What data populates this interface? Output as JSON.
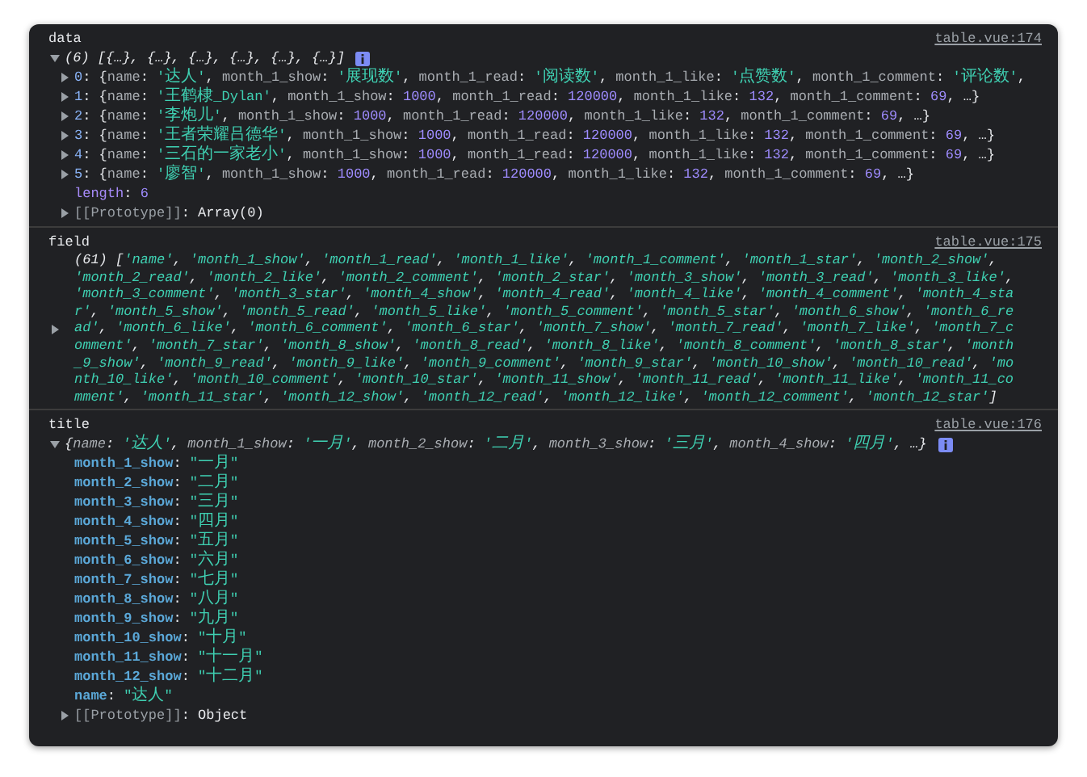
{
  "entries": [
    {
      "label": "data",
      "source": "table.vue:174",
      "expanded": true,
      "info": true,
      "summary": [
        {
          "kind": "p",
          "text": "(6) [{…}, {…}, {…}, {…}, {…}, {…}]"
        }
      ],
      "lines": [
        {
          "kind": "child",
          "expanded": false,
          "tokens": [
            {
              "kind": "x",
              "text": "0"
            },
            {
              "kind": "p",
              "text": ": {"
            },
            {
              "kind": "k",
              "text": "name"
            },
            {
              "kind": "p",
              "text": ": "
            },
            {
              "kind": "s",
              "text": "'达人'"
            },
            {
              "kind": "p",
              "text": ", "
            },
            {
              "kind": "k",
              "text": "month_1_show"
            },
            {
              "kind": "p",
              "text": ": "
            },
            {
              "kind": "s",
              "text": "'展现数'"
            },
            {
              "kind": "p",
              "text": ", "
            },
            {
              "kind": "k",
              "text": "month_1_read"
            },
            {
              "kind": "p",
              "text": ": "
            },
            {
              "kind": "s",
              "text": "'阅读数'"
            },
            {
              "kind": "p",
              "text": ", "
            },
            {
              "kind": "k",
              "text": "month_1_like"
            },
            {
              "kind": "p",
              "text": ": "
            },
            {
              "kind": "s",
              "text": "'点赞数'"
            },
            {
              "kind": "p",
              "text": ", "
            },
            {
              "kind": "k",
              "text": "month_1_comment"
            },
            {
              "kind": "p",
              "text": ": "
            },
            {
              "kind": "s",
              "text": "'评论数'"
            },
            {
              "kind": "p",
              "text": ","
            }
          ]
        },
        {
          "kind": "child",
          "expanded": false,
          "tokens": [
            {
              "kind": "x",
              "text": "1"
            },
            {
              "kind": "p",
              "text": ": {"
            },
            {
              "kind": "k",
              "text": "name"
            },
            {
              "kind": "p",
              "text": ": "
            },
            {
              "kind": "s",
              "text": "'王鹤棣_Dylan'"
            },
            {
              "kind": "p",
              "text": ", "
            },
            {
              "kind": "k",
              "text": "month_1_show"
            },
            {
              "kind": "p",
              "text": ": "
            },
            {
              "kind": "n",
              "text": "1000"
            },
            {
              "kind": "p",
              "text": ", "
            },
            {
              "kind": "k",
              "text": "month_1_read"
            },
            {
              "kind": "p",
              "text": ": "
            },
            {
              "kind": "n",
              "text": "120000"
            },
            {
              "kind": "p",
              "text": ", "
            },
            {
              "kind": "k",
              "text": "month_1_like"
            },
            {
              "kind": "p",
              "text": ": "
            },
            {
              "kind": "n",
              "text": "132"
            },
            {
              "kind": "p",
              "text": ", "
            },
            {
              "kind": "k",
              "text": "month_1_comment"
            },
            {
              "kind": "p",
              "text": ": "
            },
            {
              "kind": "n",
              "text": "69"
            },
            {
              "kind": "p",
              "text": ", …}"
            }
          ]
        },
        {
          "kind": "child",
          "expanded": false,
          "tokens": [
            {
              "kind": "x",
              "text": "2"
            },
            {
              "kind": "p",
              "text": ": {"
            },
            {
              "kind": "k",
              "text": "name"
            },
            {
              "kind": "p",
              "text": ": "
            },
            {
              "kind": "s",
              "text": "'李炮儿'"
            },
            {
              "kind": "p",
              "text": ", "
            },
            {
              "kind": "k",
              "text": "month_1_show"
            },
            {
              "kind": "p",
              "text": ": "
            },
            {
              "kind": "n",
              "text": "1000"
            },
            {
              "kind": "p",
              "text": ", "
            },
            {
              "kind": "k",
              "text": "month_1_read"
            },
            {
              "kind": "p",
              "text": ": "
            },
            {
              "kind": "n",
              "text": "120000"
            },
            {
              "kind": "p",
              "text": ", "
            },
            {
              "kind": "k",
              "text": "month_1_like"
            },
            {
              "kind": "p",
              "text": ": "
            },
            {
              "kind": "n",
              "text": "132"
            },
            {
              "kind": "p",
              "text": ", "
            },
            {
              "kind": "k",
              "text": "month_1_comment"
            },
            {
              "kind": "p",
              "text": ": "
            },
            {
              "kind": "n",
              "text": "69"
            },
            {
              "kind": "p",
              "text": ", …}"
            }
          ]
        },
        {
          "kind": "child",
          "expanded": false,
          "tokens": [
            {
              "kind": "x",
              "text": "3"
            },
            {
              "kind": "p",
              "text": ": {"
            },
            {
              "kind": "k",
              "text": "name"
            },
            {
              "kind": "p",
              "text": ": "
            },
            {
              "kind": "s",
              "text": "'王者荣耀吕德华'"
            },
            {
              "kind": "p",
              "text": ", "
            },
            {
              "kind": "k",
              "text": "month_1_show"
            },
            {
              "kind": "p",
              "text": ": "
            },
            {
              "kind": "n",
              "text": "1000"
            },
            {
              "kind": "p",
              "text": ", "
            },
            {
              "kind": "k",
              "text": "month_1_read"
            },
            {
              "kind": "p",
              "text": ": "
            },
            {
              "kind": "n",
              "text": "120000"
            },
            {
              "kind": "p",
              "text": ", "
            },
            {
              "kind": "k",
              "text": "month_1_like"
            },
            {
              "kind": "p",
              "text": ": "
            },
            {
              "kind": "n",
              "text": "132"
            },
            {
              "kind": "p",
              "text": ", "
            },
            {
              "kind": "k",
              "text": "month_1_comment"
            },
            {
              "kind": "p",
              "text": ": "
            },
            {
              "kind": "n",
              "text": "69"
            },
            {
              "kind": "p",
              "text": ", …}"
            }
          ]
        },
        {
          "kind": "child",
          "expanded": false,
          "tokens": [
            {
              "kind": "x",
              "text": "4"
            },
            {
              "kind": "p",
              "text": ": {"
            },
            {
              "kind": "k",
              "text": "name"
            },
            {
              "kind": "p",
              "text": ": "
            },
            {
              "kind": "s",
              "text": "'三石的一家老小'"
            },
            {
              "kind": "p",
              "text": ", "
            },
            {
              "kind": "k",
              "text": "month_1_show"
            },
            {
              "kind": "p",
              "text": ": "
            },
            {
              "kind": "n",
              "text": "1000"
            },
            {
              "kind": "p",
              "text": ", "
            },
            {
              "kind": "k",
              "text": "month_1_read"
            },
            {
              "kind": "p",
              "text": ": "
            },
            {
              "kind": "n",
              "text": "120000"
            },
            {
              "kind": "p",
              "text": ", "
            },
            {
              "kind": "k",
              "text": "month_1_like"
            },
            {
              "kind": "p",
              "text": ": "
            },
            {
              "kind": "n",
              "text": "132"
            },
            {
              "kind": "p",
              "text": ", "
            },
            {
              "kind": "k",
              "text": "month_1_comment"
            },
            {
              "kind": "p",
              "text": ": "
            },
            {
              "kind": "n",
              "text": "69"
            },
            {
              "kind": "p",
              "text": ", …}"
            }
          ]
        },
        {
          "kind": "child",
          "expanded": false,
          "tokens": [
            {
              "kind": "x",
              "text": "5"
            },
            {
              "kind": "p",
              "text": ": {"
            },
            {
              "kind": "k",
              "text": "name"
            },
            {
              "kind": "p",
              "text": ": "
            },
            {
              "kind": "s",
              "text": "'廖智'"
            },
            {
              "kind": "p",
              "text": ", "
            },
            {
              "kind": "k",
              "text": "month_1_show"
            },
            {
              "kind": "p",
              "text": ": "
            },
            {
              "kind": "n",
              "text": "1000"
            },
            {
              "kind": "p",
              "text": ", "
            },
            {
              "kind": "k",
              "text": "month_1_read"
            },
            {
              "kind": "p",
              "text": ": "
            },
            {
              "kind": "n",
              "text": "120000"
            },
            {
              "kind": "p",
              "text": ", "
            },
            {
              "kind": "k",
              "text": "month_1_like"
            },
            {
              "kind": "p",
              "text": ": "
            },
            {
              "kind": "n",
              "text": "132"
            },
            {
              "kind": "p",
              "text": ", "
            },
            {
              "kind": "k",
              "text": "month_1_comment"
            },
            {
              "kind": "p",
              "text": ": "
            },
            {
              "kind": "n",
              "text": "69"
            },
            {
              "kind": "p",
              "text": ", …}"
            }
          ]
        },
        {
          "kind": "prop",
          "tokens": [
            {
              "kind": "m",
              "text": "length"
            },
            {
              "kind": "p",
              "text": ": "
            },
            {
              "kind": "n",
              "text": "6"
            }
          ]
        },
        {
          "kind": "child",
          "expanded": false,
          "tokens": [
            {
              "kind": "g",
              "text": "[[Prototype]]"
            },
            {
              "kind": "p",
              "text": ": "
            },
            {
              "kind": "p",
              "text": "Array(0)"
            }
          ]
        }
      ]
    },
    {
      "label": "field",
      "source": "table.vue:175",
      "expanded": false,
      "info": false,
      "summary": [
        {
          "kind": "p",
          "text": "(61) ["
        },
        {
          "kind": "s",
          "text": "'name'"
        },
        {
          "kind": "p",
          "text": ", "
        },
        {
          "kind": "s",
          "text": "'month_1_show'"
        },
        {
          "kind": "p",
          "text": ", "
        },
        {
          "kind": "s",
          "text": "'month_1_read'"
        },
        {
          "kind": "p",
          "text": ", "
        },
        {
          "kind": "s",
          "text": "'month_1_like'"
        },
        {
          "kind": "p",
          "text": ", "
        },
        {
          "kind": "s",
          "text": "'month_1_comment'"
        },
        {
          "kind": "p",
          "text": ", "
        },
        {
          "kind": "s",
          "text": "'month_1_star'"
        },
        {
          "kind": "p",
          "text": ", "
        },
        {
          "kind": "s",
          "text": "'month_2_show'"
        },
        {
          "kind": "p",
          "text": ", "
        },
        {
          "kind": "s",
          "text": "'month_2_read'"
        },
        {
          "kind": "p",
          "text": ", "
        },
        {
          "kind": "s",
          "text": "'month_2_like'"
        },
        {
          "kind": "p",
          "text": ", "
        },
        {
          "kind": "s",
          "text": "'month_2_comment'"
        },
        {
          "kind": "p",
          "text": ", "
        },
        {
          "kind": "s",
          "text": "'month_2_star'"
        },
        {
          "kind": "p",
          "text": ", "
        },
        {
          "kind": "s",
          "text": "'month_3_show'"
        },
        {
          "kind": "p",
          "text": ", "
        },
        {
          "kind": "s",
          "text": "'month_3_read'"
        },
        {
          "kind": "p",
          "text": ", "
        },
        {
          "kind": "s",
          "text": "'month_3_like'"
        },
        {
          "kind": "p",
          "text": ", "
        },
        {
          "kind": "s",
          "text": "'month_3_comment'"
        },
        {
          "kind": "p",
          "text": ", "
        },
        {
          "kind": "s",
          "text": "'month_3_star'"
        },
        {
          "kind": "p",
          "text": ", "
        },
        {
          "kind": "s",
          "text": "'month_4_show'"
        },
        {
          "kind": "p",
          "text": ", "
        },
        {
          "kind": "s",
          "text": "'month_4_read'"
        },
        {
          "kind": "p",
          "text": ", "
        },
        {
          "kind": "s",
          "text": "'month_4_like'"
        },
        {
          "kind": "p",
          "text": ", "
        },
        {
          "kind": "s",
          "text": "'month_4_comment'"
        },
        {
          "kind": "p",
          "text": ", "
        },
        {
          "kind": "s",
          "text": "'month_4_star'"
        },
        {
          "kind": "p",
          "text": ", "
        },
        {
          "kind": "s",
          "text": "'month_5_show'"
        },
        {
          "kind": "p",
          "text": ", "
        },
        {
          "kind": "s",
          "text": "'month_5_read'"
        },
        {
          "kind": "p",
          "text": ", "
        },
        {
          "kind": "s",
          "text": "'month_5_like'"
        },
        {
          "kind": "p",
          "text": ", "
        },
        {
          "kind": "s",
          "text": "'month_5_comment'"
        },
        {
          "kind": "p",
          "text": ", "
        },
        {
          "kind": "s",
          "text": "'month_5_star'"
        },
        {
          "kind": "p",
          "text": ", "
        },
        {
          "kind": "s",
          "text": "'month_6_show'"
        },
        {
          "kind": "p",
          "text": ", "
        },
        {
          "kind": "s",
          "text": "'month_6_read'"
        },
        {
          "kind": "p",
          "text": ", "
        },
        {
          "kind": "s",
          "text": "'month_6_like'"
        },
        {
          "kind": "p",
          "text": ", "
        },
        {
          "kind": "s",
          "text": "'month_6_comment'"
        },
        {
          "kind": "p",
          "text": ", "
        },
        {
          "kind": "s",
          "text": "'month_6_star'"
        },
        {
          "kind": "p",
          "text": ", "
        },
        {
          "kind": "s",
          "text": "'month_7_show'"
        },
        {
          "kind": "p",
          "text": ", "
        },
        {
          "kind": "s",
          "text": "'month_7_read'"
        },
        {
          "kind": "p",
          "text": ", "
        },
        {
          "kind": "s",
          "text": "'month_7_like'"
        },
        {
          "kind": "p",
          "text": ", "
        },
        {
          "kind": "s",
          "text": "'month_7_comment'"
        },
        {
          "kind": "p",
          "text": ", "
        },
        {
          "kind": "s",
          "text": "'month_7_star'"
        },
        {
          "kind": "p",
          "text": ", "
        },
        {
          "kind": "s",
          "text": "'month_8_show'"
        },
        {
          "kind": "p",
          "text": ", "
        },
        {
          "kind": "s",
          "text": "'month_8_read'"
        },
        {
          "kind": "p",
          "text": ", "
        },
        {
          "kind": "s",
          "text": "'month_8_like'"
        },
        {
          "kind": "p",
          "text": ", "
        },
        {
          "kind": "s",
          "text": "'month_8_comment'"
        },
        {
          "kind": "p",
          "text": ", "
        },
        {
          "kind": "s",
          "text": "'month_8_star'"
        },
        {
          "kind": "p",
          "text": ", "
        },
        {
          "kind": "s",
          "text": "'month_9_show'"
        },
        {
          "kind": "p",
          "text": ", "
        },
        {
          "kind": "s",
          "text": "'month_9_read'"
        },
        {
          "kind": "p",
          "text": ", "
        },
        {
          "kind": "s",
          "text": "'month_9_like'"
        },
        {
          "kind": "p",
          "text": ", "
        },
        {
          "kind": "s",
          "text": "'month_9_comment'"
        },
        {
          "kind": "p",
          "text": ", "
        },
        {
          "kind": "s",
          "text": "'month_9_star'"
        },
        {
          "kind": "p",
          "text": ", "
        },
        {
          "kind": "s",
          "text": "'month_10_show'"
        },
        {
          "kind": "p",
          "text": ", "
        },
        {
          "kind": "s",
          "text": "'month_10_read'"
        },
        {
          "kind": "p",
          "text": ", "
        },
        {
          "kind": "s",
          "text": "'month_10_like'"
        },
        {
          "kind": "p",
          "text": ", "
        },
        {
          "kind": "s",
          "text": "'month_10_comment'"
        },
        {
          "kind": "p",
          "text": ", "
        },
        {
          "kind": "s",
          "text": "'month_10_star'"
        },
        {
          "kind": "p",
          "text": ", "
        },
        {
          "kind": "s",
          "text": "'month_11_show'"
        },
        {
          "kind": "p",
          "text": ", "
        },
        {
          "kind": "s",
          "text": "'month_11_read'"
        },
        {
          "kind": "p",
          "text": ", "
        },
        {
          "kind": "s",
          "text": "'month_11_like'"
        },
        {
          "kind": "p",
          "text": ", "
        },
        {
          "kind": "s",
          "text": "'month_11_comment'"
        },
        {
          "kind": "p",
          "text": ", "
        },
        {
          "kind": "s",
          "text": "'month_11_star'"
        },
        {
          "kind": "p",
          "text": ", "
        },
        {
          "kind": "s",
          "text": "'month_12_show'"
        },
        {
          "kind": "p",
          "text": ", "
        },
        {
          "kind": "s",
          "text": "'month_12_read'"
        },
        {
          "kind": "p",
          "text": ", "
        },
        {
          "kind": "s",
          "text": "'month_12_like'"
        },
        {
          "kind": "p",
          "text": ", "
        },
        {
          "kind": "s",
          "text": "'month_12_comment'"
        },
        {
          "kind": "p",
          "text": ", "
        },
        {
          "kind": "s",
          "text": "'month_12_star'"
        },
        {
          "kind": "p",
          "text": "]"
        }
      ]
    },
    {
      "label": "title",
      "source": "table.vue:176",
      "expanded": true,
      "info": true,
      "summary": [
        {
          "kind": "p",
          "text": "{"
        },
        {
          "kind": "k",
          "text": "name"
        },
        {
          "kind": "p",
          "text": ": "
        },
        {
          "kind": "s",
          "text": "'达人'"
        },
        {
          "kind": "p",
          "text": ", "
        },
        {
          "kind": "k",
          "text": "month_1_show"
        },
        {
          "kind": "p",
          "text": ": "
        },
        {
          "kind": "s",
          "text": "'一月'"
        },
        {
          "kind": "p",
          "text": ", "
        },
        {
          "kind": "k",
          "text": "month_2_show"
        },
        {
          "kind": "p",
          "text": ": "
        },
        {
          "kind": "s",
          "text": "'二月'"
        },
        {
          "kind": "p",
          "text": ", "
        },
        {
          "kind": "k",
          "text": "month_3_show"
        },
        {
          "kind": "p",
          "text": ": "
        },
        {
          "kind": "s",
          "text": "'三月'"
        },
        {
          "kind": "p",
          "text": ", "
        },
        {
          "kind": "k",
          "text": "month_4_show"
        },
        {
          "kind": "p",
          "text": ": "
        },
        {
          "kind": "s",
          "text": "'四月'"
        },
        {
          "kind": "p",
          "text": ", …}"
        }
      ],
      "lines": [
        {
          "kind": "prop",
          "tokens": [
            {
              "kind": "b",
              "text": "month_1_show"
            },
            {
              "kind": "p",
              "text": ": "
            },
            {
              "kind": "s",
              "text": "\"一月\""
            }
          ]
        },
        {
          "kind": "prop",
          "tokens": [
            {
              "kind": "b",
              "text": "month_2_show"
            },
            {
              "kind": "p",
              "text": ": "
            },
            {
              "kind": "s",
              "text": "\"二月\""
            }
          ]
        },
        {
          "kind": "prop",
          "tokens": [
            {
              "kind": "b",
              "text": "month_3_show"
            },
            {
              "kind": "p",
              "text": ": "
            },
            {
              "kind": "s",
              "text": "\"三月\""
            }
          ]
        },
        {
          "kind": "prop",
          "tokens": [
            {
              "kind": "b",
              "text": "month_4_show"
            },
            {
              "kind": "p",
              "text": ": "
            },
            {
              "kind": "s",
              "text": "\"四月\""
            }
          ]
        },
        {
          "kind": "prop",
          "tokens": [
            {
              "kind": "b",
              "text": "month_5_show"
            },
            {
              "kind": "p",
              "text": ": "
            },
            {
              "kind": "s",
              "text": "\"五月\""
            }
          ]
        },
        {
          "kind": "prop",
          "tokens": [
            {
              "kind": "b",
              "text": "month_6_show"
            },
            {
              "kind": "p",
              "text": ": "
            },
            {
              "kind": "s",
              "text": "\"六月\""
            }
          ]
        },
        {
          "kind": "prop",
          "tokens": [
            {
              "kind": "b",
              "text": "month_7_show"
            },
            {
              "kind": "p",
              "text": ": "
            },
            {
              "kind": "s",
              "text": "\"七月\""
            }
          ]
        },
        {
          "kind": "prop",
          "tokens": [
            {
              "kind": "b",
              "text": "month_8_show"
            },
            {
              "kind": "p",
              "text": ": "
            },
            {
              "kind": "s",
              "text": "\"八月\""
            }
          ]
        },
        {
          "kind": "prop",
          "tokens": [
            {
              "kind": "b",
              "text": "month_9_show"
            },
            {
              "kind": "p",
              "text": ": "
            },
            {
              "kind": "s",
              "text": "\"九月\""
            }
          ]
        },
        {
          "kind": "prop",
          "tokens": [
            {
              "kind": "b",
              "text": "month_10_show"
            },
            {
              "kind": "p",
              "text": ": "
            },
            {
              "kind": "s",
              "text": "\"十月\""
            }
          ]
        },
        {
          "kind": "prop",
          "tokens": [
            {
              "kind": "b",
              "text": "month_11_show"
            },
            {
              "kind": "p",
              "text": ": "
            },
            {
              "kind": "s",
              "text": "\"十一月\""
            }
          ]
        },
        {
          "kind": "prop",
          "tokens": [
            {
              "kind": "b",
              "text": "month_12_show"
            },
            {
              "kind": "p",
              "text": ": "
            },
            {
              "kind": "s",
              "text": "\"十二月\""
            }
          ]
        },
        {
          "kind": "prop",
          "tokens": [
            {
              "kind": "b",
              "text": "name"
            },
            {
              "kind": "p",
              "text": ": "
            },
            {
              "kind": "s",
              "text": "\"达人\""
            }
          ]
        },
        {
          "kind": "child",
          "expanded": false,
          "tokens": [
            {
              "kind": "g",
              "text": "[[Prototype]]"
            },
            {
              "kind": "p",
              "text": ": "
            },
            {
              "kind": "p",
              "text": "Object"
            }
          ]
        }
      ]
    }
  ]
}
